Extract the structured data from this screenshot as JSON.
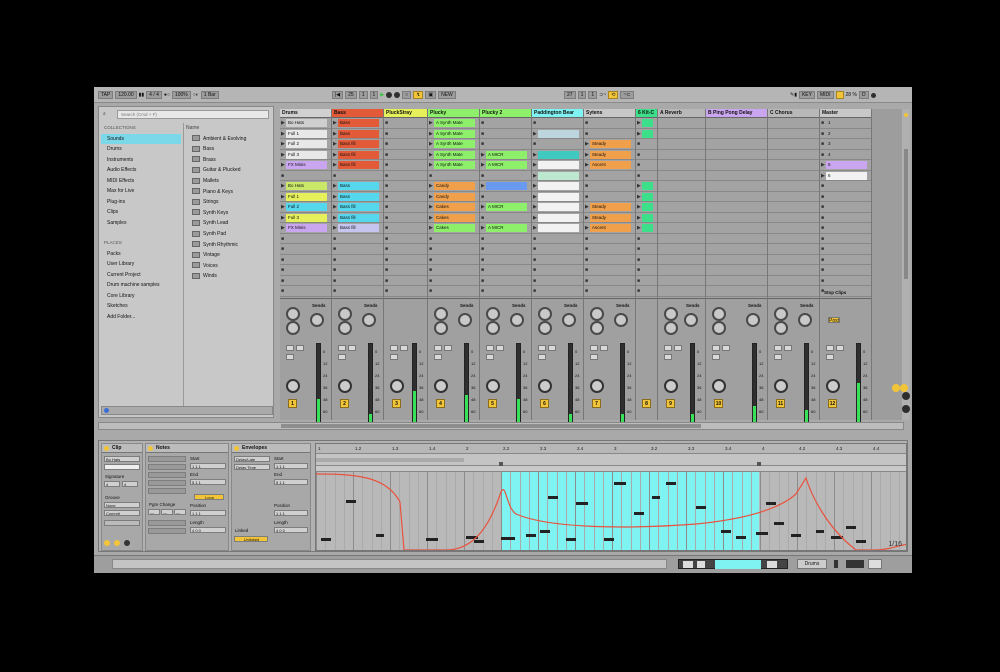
{
  "toolbar": {
    "tap": "TAP",
    "tempo": "120.00",
    "sig": "4 / 4",
    "zoom": "100%",
    "quant": "1 Bar",
    "pos": "25",
    "bar2": "1",
    "bar3": "1",
    "new": "NEW",
    "loop_start": "27",
    "loop_end": "1",
    "loop_len": "1",
    "key": "KEY",
    "midi": "MIDI",
    "cpu": "28 %",
    "d": "D"
  },
  "browser": {
    "search_placeholder": "Search (Cmd + F)",
    "collections_header": "COLLECTIONS",
    "categories": [
      "Sounds",
      "Drums",
      "Instruments",
      "Audio Effects",
      "MIDI Effects",
      "Max for Live",
      "Plug-ins",
      "Clips",
      "Samples"
    ],
    "places_header": "PLACES",
    "places": [
      "Packs",
      "User Library",
      "Current Project",
      "Drum machine samples",
      "Core Library",
      "Sketches",
      "Add Folder..."
    ],
    "items_header": "Name",
    "items": [
      "Ambient & Evolving",
      "Bass",
      "Brass",
      "Guitar & Plucked",
      "Mallets",
      "Piano & Keys",
      "Strings",
      "Synth Keys",
      "Synth Lead",
      "Synth Pad",
      "Synth Rhythmic",
      "Vintage",
      "Voices",
      "Winds"
    ]
  },
  "tracks": [
    {
      "name": "Drums",
      "color": "#d0d0d0",
      "clips": [
        {
          "t": "Bo Hats",
          "c": "#cfcfcf",
          "p": "#26c73a"
        },
        {
          "t": "Full 1",
          "c": "#e8e8e8"
        },
        {
          "t": "Full 2",
          "c": "#e8e8e8"
        },
        {
          "t": "Full 3",
          "c": "#e8e8e8"
        },
        {
          "t": "FX Minis",
          "c": "#cba6f0"
        },
        {
          "t": "",
          "c": ""
        },
        {
          "t": "Bo Hats",
          "c": "#c9e86a"
        },
        {
          "t": "Full 1",
          "c": "#e6f05a"
        },
        {
          "t": "Full 2",
          "c": "#55d7ee"
        },
        {
          "t": "Full 3",
          "c": "#e6f05a"
        },
        {
          "t": "FX Minis",
          "c": "#cba6f0"
        }
      ]
    },
    {
      "name": "Bass",
      "color": "#e35a39",
      "clips": [
        {
          "t": "Bass",
          "c": "#e35a39"
        },
        {
          "t": "Bass",
          "c": "#e35a39"
        },
        {
          "t": "Bass fill",
          "c": "#e35a39"
        },
        {
          "t": "Bass fill",
          "c": "#e35a39"
        },
        {
          "t": "Bass fill",
          "c": "#e35a39"
        },
        {
          "t": "",
          "c": ""
        },
        {
          "t": "Bass",
          "c": "#55d7ee"
        },
        {
          "t": "Bass",
          "c": "#55d7ee"
        },
        {
          "t": "Bass fill",
          "c": "#55d7ee"
        },
        {
          "t": "Bass fill",
          "c": "#55d7ee"
        },
        {
          "t": "Bass fill",
          "c": "#c5c5f0"
        }
      ]
    },
    {
      "name": "PluckStray",
      "color": "#e6f05a",
      "clips": []
    },
    {
      "name": "Plucky",
      "color": "#8ef06a",
      "clips": [
        {
          "t": "A Synth Mate",
          "c": "#8ef06a"
        },
        {
          "t": "A Synth Mate",
          "c": "#8ef06a"
        },
        {
          "t": "A Synth Mate",
          "c": "#8ef06a"
        },
        {
          "t": "A Synth Mate",
          "c": "#8ef06a"
        },
        {
          "t": "A Synth Mate",
          "c": "#8ef06a"
        },
        {
          "t": "",
          "c": ""
        },
        {
          "t": "Candy",
          "c": "#f0a04a"
        },
        {
          "t": "Candy",
          "c": "#f0a04a"
        },
        {
          "t": "Cakes",
          "c": "#f0a04a"
        },
        {
          "t": "Cakes",
          "c": "#f0a04a"
        },
        {
          "t": "Cakes",
          "c": "#8ef06a"
        }
      ]
    },
    {
      "name": "Plucky 2",
      "color": "#8ef06a",
      "clips": [
        {
          "t": "",
          "c": ""
        },
        {
          "t": "",
          "c": ""
        },
        {
          "t": "",
          "c": ""
        },
        {
          "t": "A MICR",
          "c": "#8ef06a"
        },
        {
          "t": "A MICR",
          "c": "#8ef06a"
        },
        {
          "t": "",
          "c": ""
        },
        {
          "t": "",
          "c": "#6a9af0"
        },
        {
          "t": "",
          "c": ""
        },
        {
          "t": "A MICR",
          "c": "#8ef06a"
        },
        {
          "t": "",
          "c": ""
        },
        {
          "t": "A MICR",
          "c": "#8ef06a"
        }
      ]
    },
    {
      "name": "Paddington Bear",
      "color": "#7ff2f2",
      "clips": [
        {
          "t": "",
          "c": ""
        },
        {
          "t": "",
          "c": "#bdd5dc"
        },
        {
          "t": "",
          "c": ""
        },
        {
          "t": "",
          "c": "#3fc9c0"
        },
        {
          "t": "",
          "c": "#f2f2f2"
        },
        {
          "t": "",
          "c": "#bde8d0"
        },
        {
          "t": "",
          "c": "#f2f2f2"
        },
        {
          "t": "",
          "c": "#f2f2f2"
        },
        {
          "t": "",
          "c": "#f2f2f2"
        },
        {
          "t": "",
          "c": "#f2f2f2"
        },
        {
          "t": "",
          "c": "#f2f2f2"
        }
      ]
    },
    {
      "name": "Sytens",
      "color": "#c8c8c8",
      "clips": [
        {
          "t": "",
          "c": ""
        },
        {
          "t": "",
          "c": ""
        },
        {
          "t": "Steady",
          "c": "#f0a04a"
        },
        {
          "t": "Steady",
          "c": "#f0a04a"
        },
        {
          "t": "Ascent",
          "c": "#f0a04a"
        },
        {
          "t": "",
          "c": ""
        },
        {
          "t": "",
          "c": ""
        },
        {
          "t": "",
          "c": ""
        },
        {
          "t": "Steady",
          "c": "#f0a04a"
        },
        {
          "t": "Steady",
          "c": "#f0a04a"
        },
        {
          "t": "Ascent",
          "c": "#f0a04a"
        }
      ]
    },
    {
      "name": "6 Kit-C",
      "color": "#3ce08a",
      "clips": [
        {
          "t": "",
          "c": "#3ce08a"
        },
        {
          "t": "",
          "c": "#3ce08a"
        },
        {
          "t": "",
          "c": ""
        },
        {
          "t": "",
          "c": ""
        },
        {
          "t": "",
          "c": ""
        },
        {
          "t": "",
          "c": ""
        },
        {
          "t": "",
          "c": "#3ce08a"
        },
        {
          "t": "",
          "c": "#3ce08a"
        },
        {
          "t": "",
          "c": "#3ce08a"
        },
        {
          "t": "",
          "c": "#3ce08a"
        },
        {
          "t": "",
          "c": "#3ce08a"
        }
      ]
    },
    {
      "name": "A Reverb",
      "color": "#b8b8b8",
      "clips": []
    },
    {
      "name": "B Ping Pong Delay",
      "color": "#cba6f0",
      "clips": []
    },
    {
      "name": "C Chorus",
      "color": "#b8b8b8",
      "clips": []
    },
    {
      "name": "Master",
      "color": "#c8c8c8",
      "clips": [
        {
          "t": "1",
          "c": ""
        },
        {
          "t": "2",
          "c": ""
        },
        {
          "t": "3",
          "c": ""
        },
        {
          "t": "4",
          "c": ""
        },
        {
          "t": "5",
          "c": "#cba6f0"
        },
        {
          "t": "6",
          "c": "#f2f2f2"
        }
      ]
    }
  ],
  "mixer": {
    "sends": "Sends",
    "stop_clips": "Stop Clips",
    "post": "Post",
    "db_scale": [
      "0",
      "12",
      "24",
      "36",
      "48",
      "60"
    ]
  },
  "clip_panel": {
    "title": "Clip",
    "name": "Bo Hats",
    "signature": "Signature",
    "groove": "Groove",
    "commit": "Commit"
  },
  "notes_panel": {
    "title": "Notes",
    "start": "Start",
    "end": "End",
    "pgm_change": "Pgm Change",
    "position": "Position",
    "length": "Length",
    "loop": "Loop"
  },
  "env_panel": {
    "title": "Envelopes",
    "device": "Delay/Late",
    "control": "Delay Time",
    "start": "Start",
    "end": "End",
    "position": "Position",
    "length": "Length",
    "linked": "Linked",
    "unlinked": "Unlinked"
  },
  "piano": {
    "ruler": [
      "1",
      "1.2",
      "1.3",
      "1.4",
      "2",
      "2.2",
      "2.3",
      "2.4",
      "3",
      "3.2",
      "3.3",
      "3.4",
      "4",
      "4.2",
      "4.3",
      "4.4"
    ],
    "grid_label": "1/16"
  },
  "status": {
    "track": "Drums"
  }
}
